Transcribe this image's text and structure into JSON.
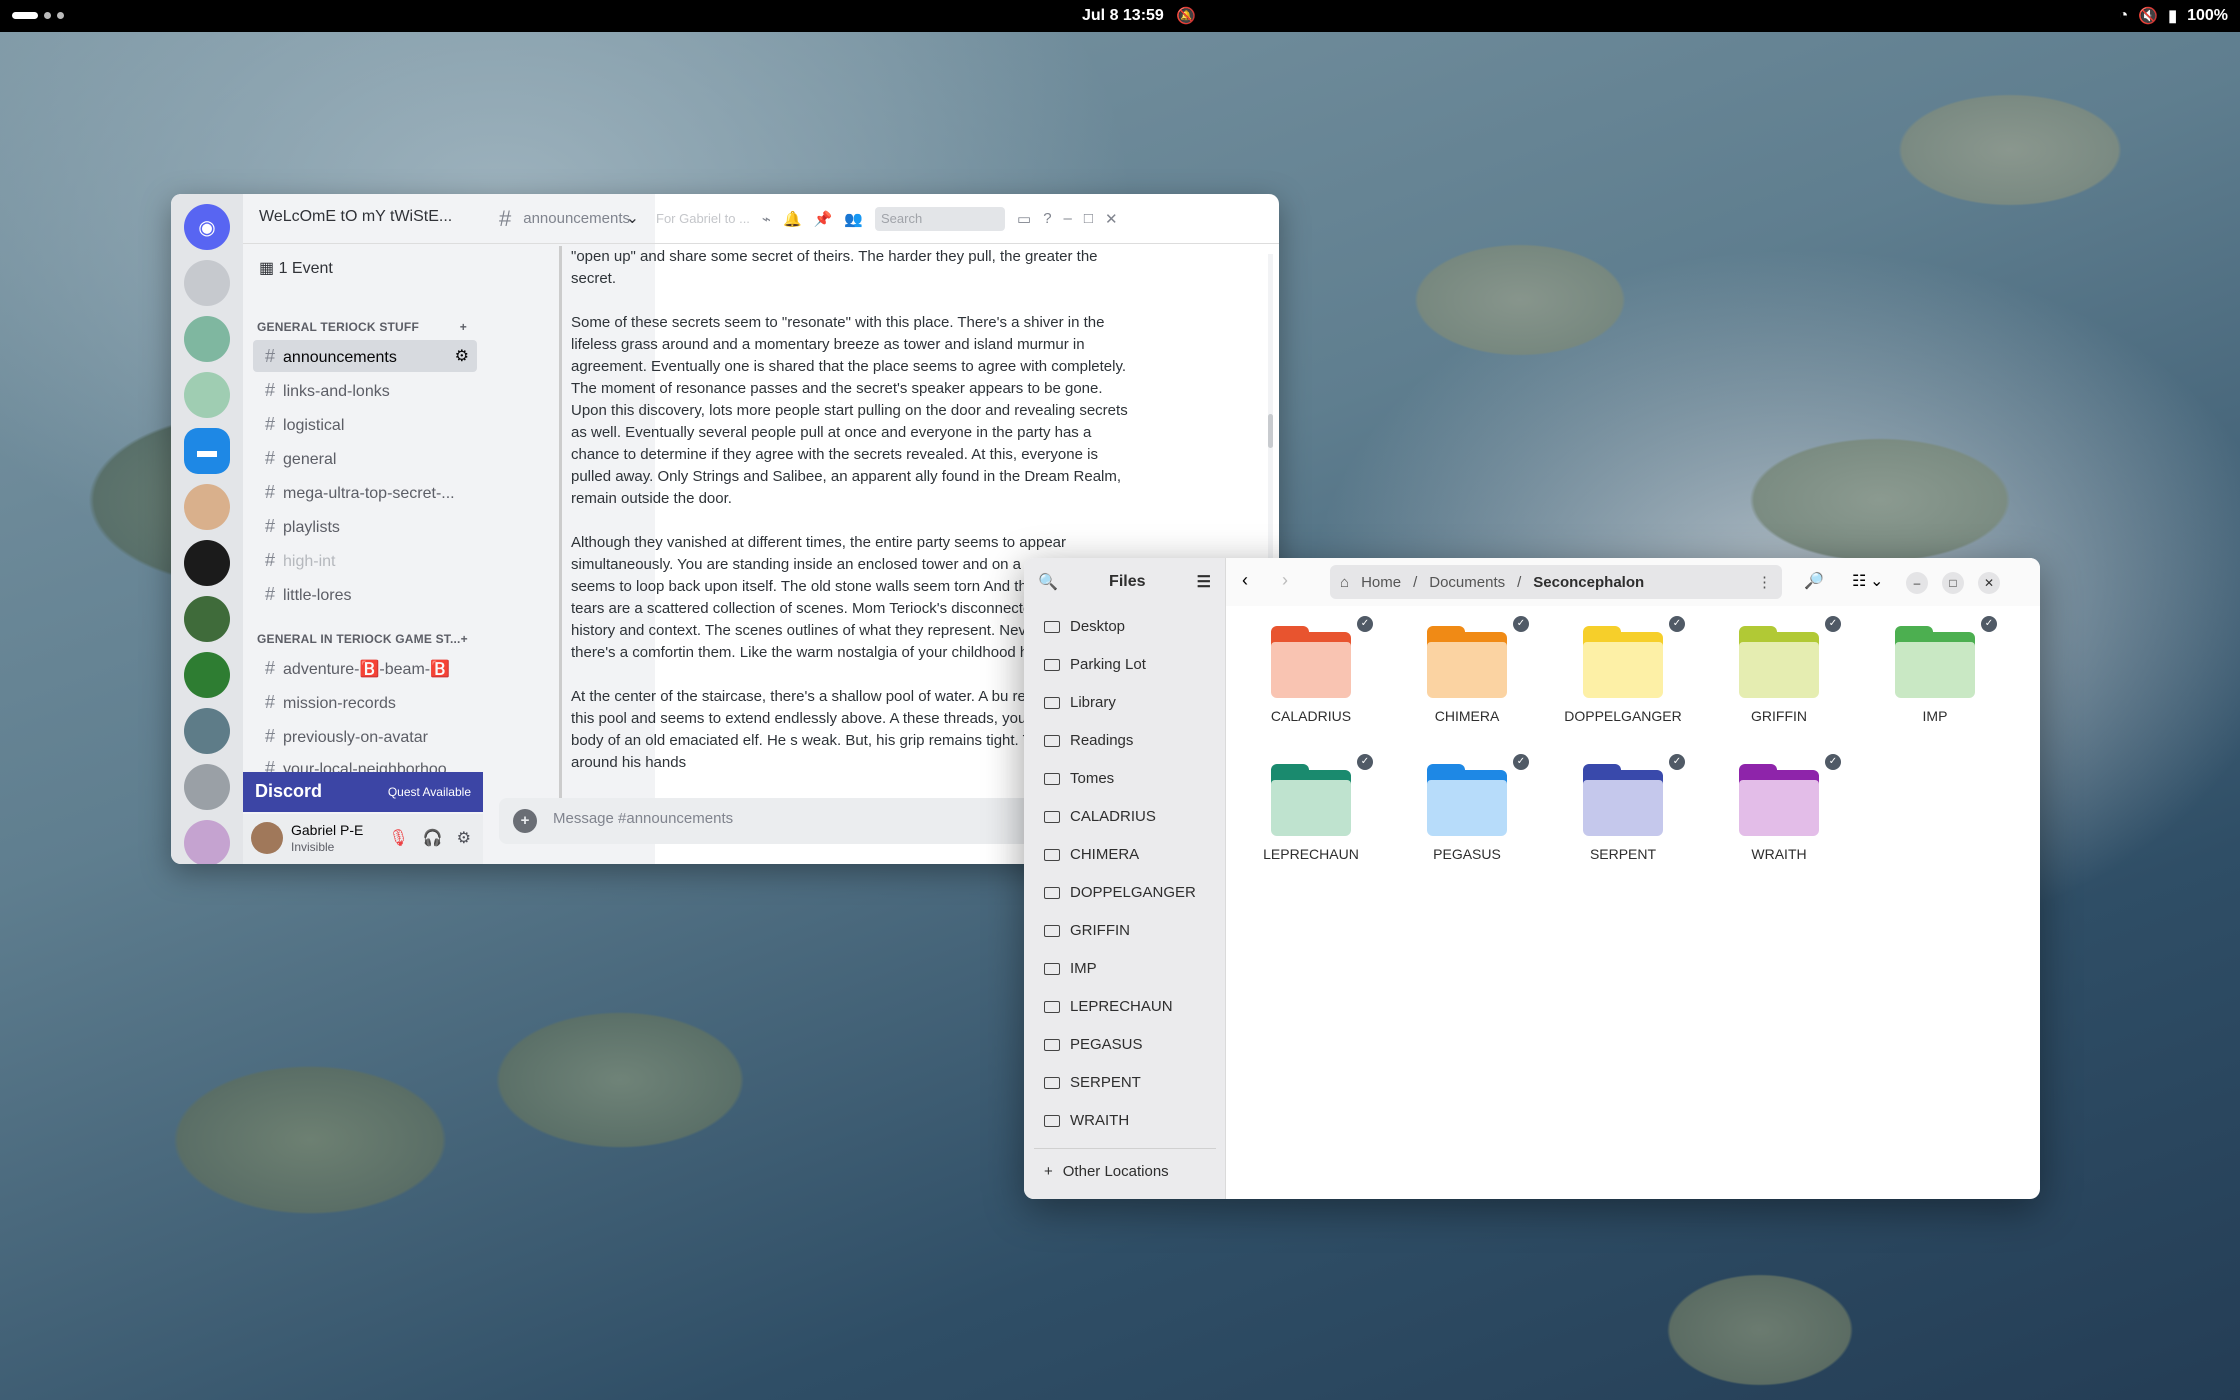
{
  "topbar": {
    "datetime": "Jul 8  13:59",
    "battery": "100%"
  },
  "discord": {
    "guild_name": "WeLcOmE tO mY tWiStE...",
    "event": "1 Event",
    "categories": [
      "GENERAL TERIOCK STUFF",
      "GENERAL IN TERIOCK GAME ST..."
    ],
    "channels_a": [
      "announcements",
      "links-and-lonks",
      "logistical",
      "general",
      "mega-ultra-top-secret-...",
      "playlists",
      "high-int",
      "little-lores"
    ],
    "channels_b": [
      "adventure-🅱️-beam-🅱️",
      "mission-records",
      "previously-on-avatar",
      "your-local-neighborhoo..."
    ],
    "banner": {
      "logo": "Discord",
      "quest": "Quest Available"
    },
    "user": {
      "name": "Gabriel P-E",
      "status": "Invisible"
    },
    "channel_title": "announcements",
    "topic": "For Gabriel to ...",
    "search_placeholder": "Search",
    "compose_placeholder": "Message #announcements",
    "messages": [
      "\"open up\" and share some secret of theirs. The harder they pull, the greater the secret.",
      "Some of these secrets seem to \"resonate\" with this place. There's a shiver in the lifeless grass around and a momentary breeze as tower and island murmur in agreement. Eventually one is shared that the place seems to agree with completely. The moment of resonance passes and the secret's speaker appears to be gone. Upon this discovery, lots more people start pulling on the door and revealing secrets as well. Eventually several people pull at once and everyone in the party has a chance to determine if they agree with the secrets revealed. At this, everyone is pulled away. Only Strings and Salibee, an apparent ally found in the Dream Realm, remain outside the door.",
      "Although they vanished at different times, the entire party seems to appear simultaneously. You are standing inside an enclosed tower and on a staircase that seems to loop back upon itself. The old stone walls seem torn And through these tears are a scattered collection of scenes. Mom Teriock's disconnected from their history and context. The scenes outlines of what they represent. Nevertheless, there's a comfortin them. Like the warm nostalgia of your childhood home.",
      "At the center of the staircase, there's a shallow pool of water. A bu reaches up from this pool and seems to extend endlessly above. A these threads, you see the tired body of an old emaciated elf. He s weak. But, his grip remains tight. The threads tie around his hands"
    ]
  },
  "files": {
    "title": "Files",
    "sidebar": [
      "Desktop",
      "Parking Lot",
      "Library",
      "Readings",
      "Tomes",
      "CALADRIUS",
      "CHIMERA",
      "DOPPELGANGER",
      "GRIFFIN",
      "IMP",
      "LEPRECHAUN",
      "PEGASUS",
      "SERPENT",
      "WRAITH"
    ],
    "other_locations": "Other Locations",
    "breadcrumb": [
      "Home",
      "Documents",
      "Seconcephalon"
    ],
    "folders": [
      {
        "name": "CALADRIUS",
        "color": "#e8542f",
        "light": "#f9c4b2"
      },
      {
        "name": "CHIMERA",
        "color": "#f08a15",
        "light": "#fbd3a2"
      },
      {
        "name": "DOPPELGANGER",
        "color": "#f6cf2a",
        "light": "#fdf0a6"
      },
      {
        "name": "GRIFFIN",
        "color": "#b1c935",
        "light": "#e5edb1"
      },
      {
        "name": "IMP",
        "color": "#4caf50",
        "light": "#c9e8c4"
      },
      {
        "name": "LEPRECHAUN",
        "color": "#1a8a6e",
        "light": "#bfe3cf"
      },
      {
        "name": "PEGASUS",
        "color": "#1e88e5",
        "light": "#b7dcfa"
      },
      {
        "name": "SERPENT",
        "color": "#3949ab",
        "light": "#c5c8ec"
      },
      {
        "name": "WRAITH",
        "color": "#8e24aa",
        "light": "#e3bde8"
      }
    ]
  }
}
